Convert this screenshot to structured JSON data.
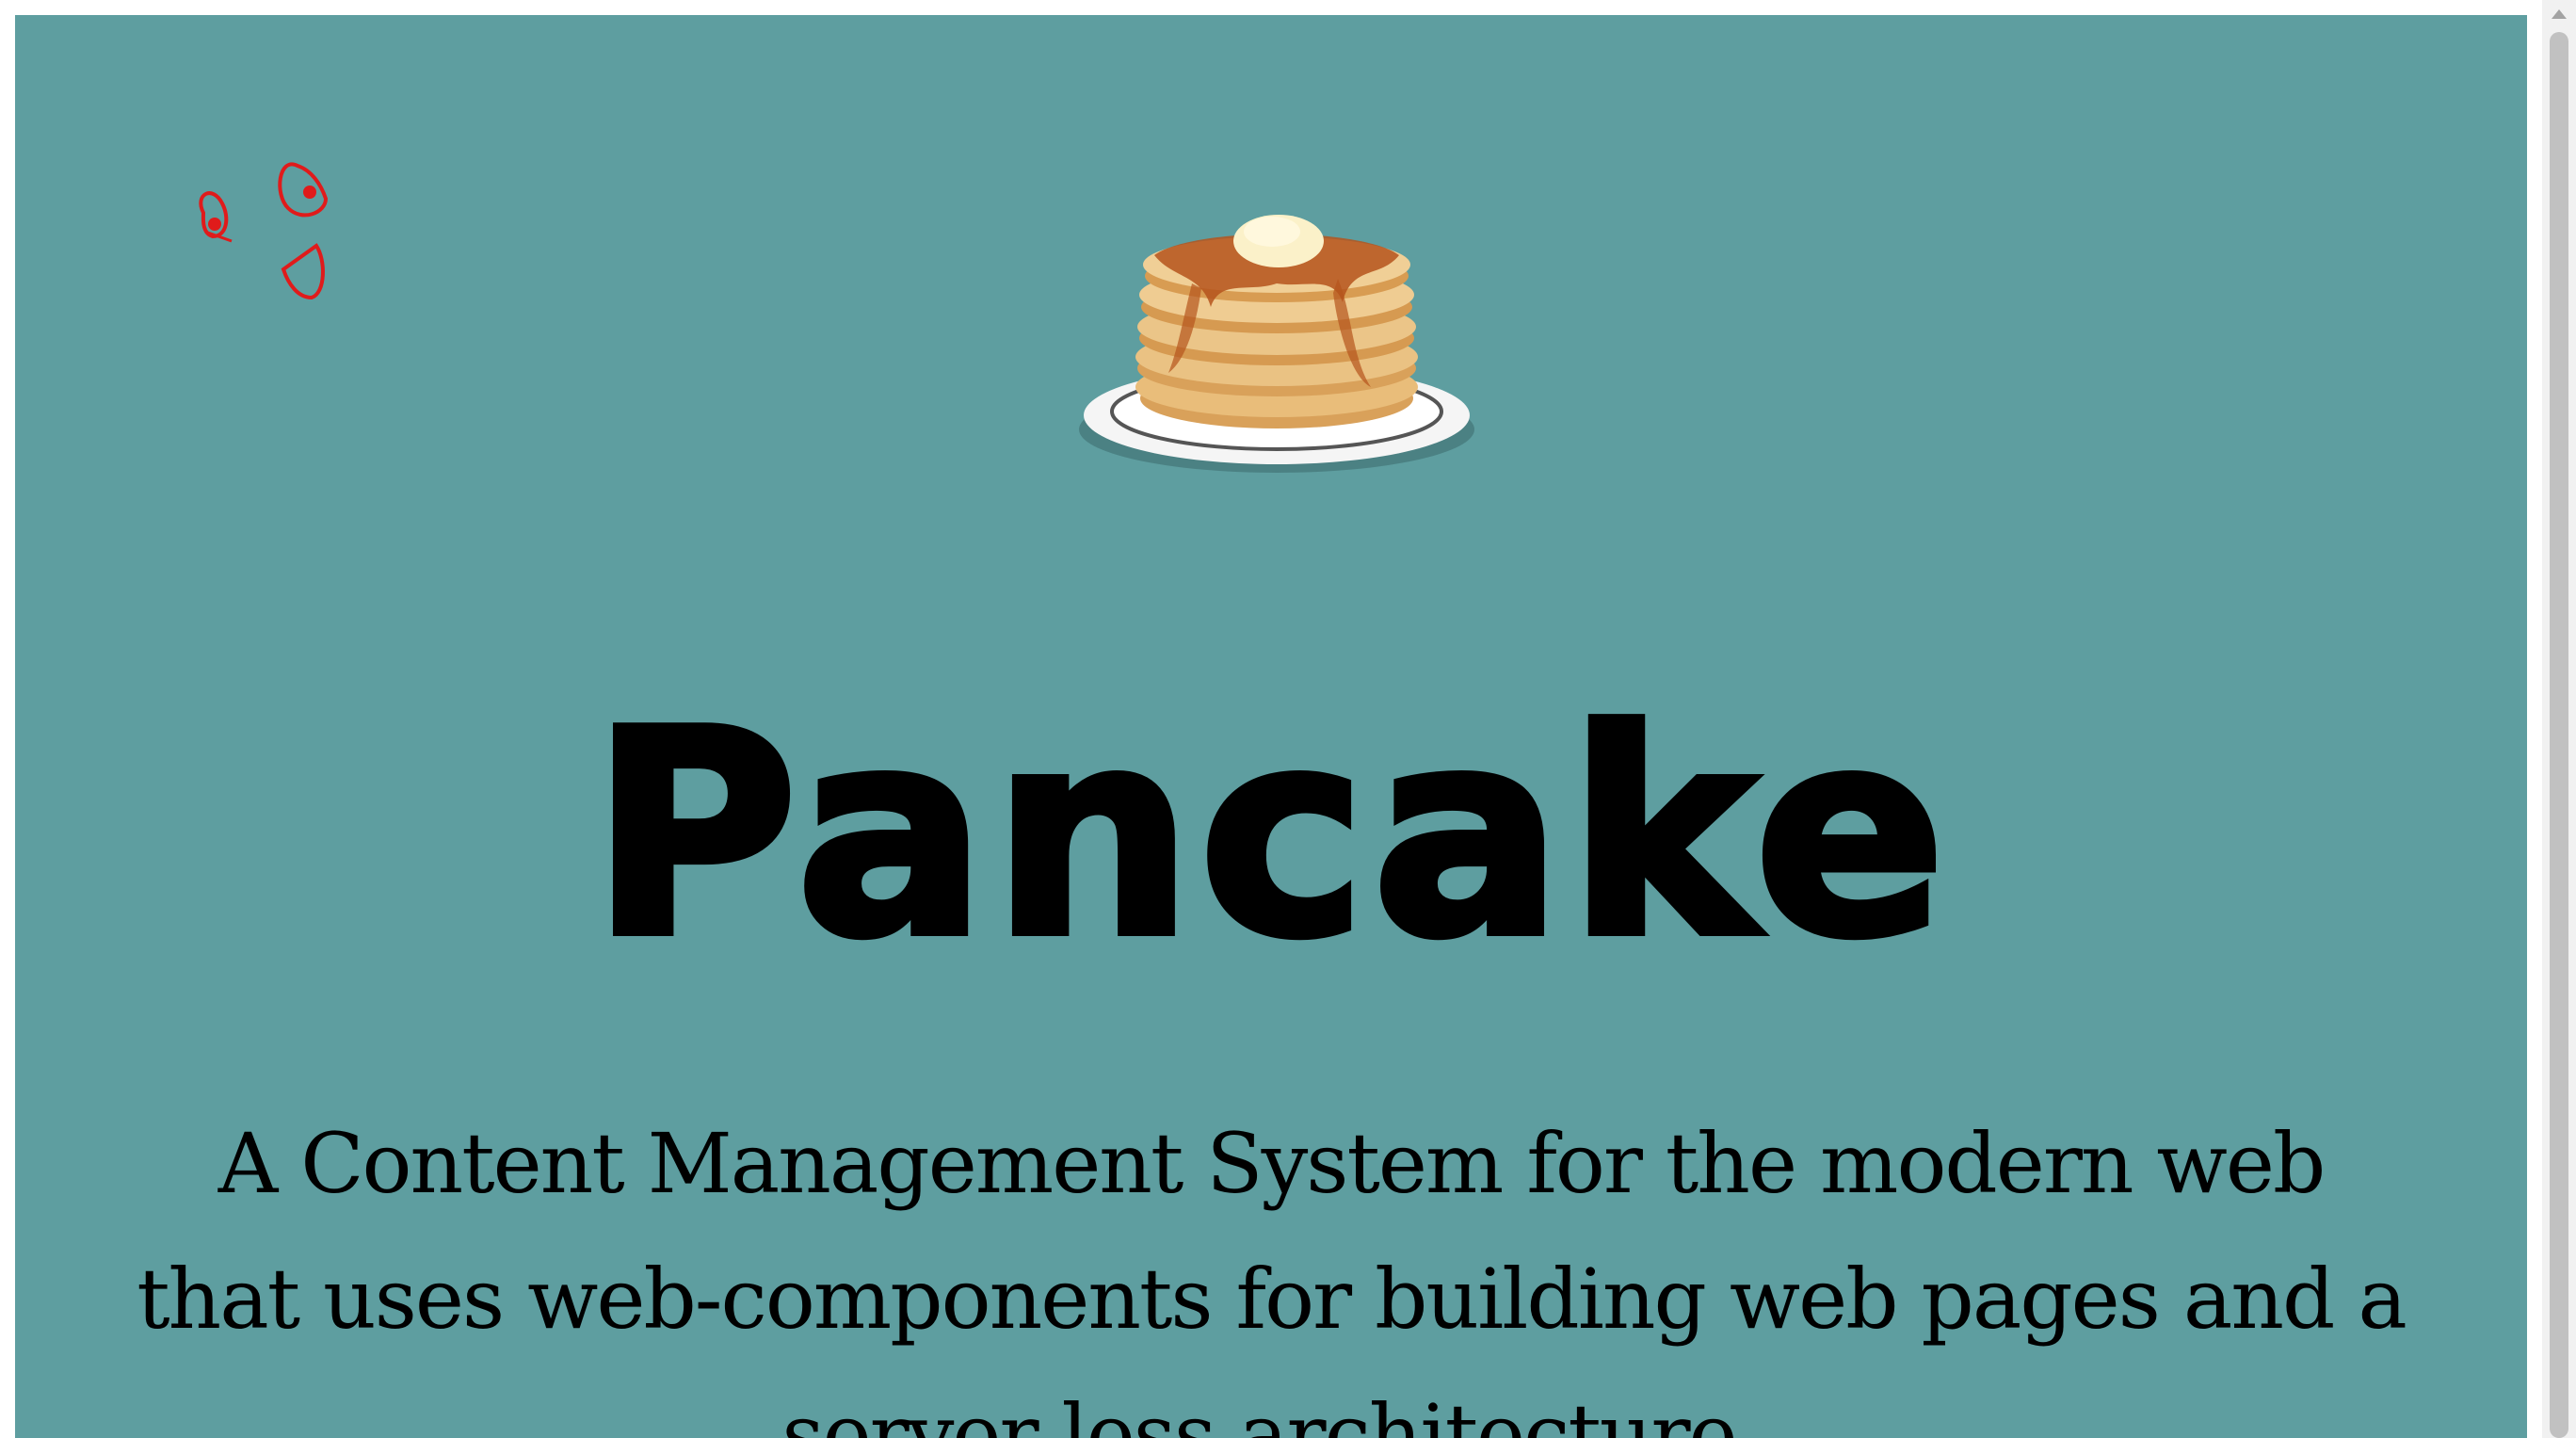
{
  "hero": {
    "title": "Pancake",
    "tagline": "A Content Management System for the modern web that uses web-components for building web pages and a server less architecture."
  },
  "images": {
    "logo": "pancake-stack-image",
    "doodle": "doodle-face-icon"
  },
  "colors": {
    "background": "#5e9ea0",
    "text": "#000000",
    "doodle": "#e01b1b"
  }
}
